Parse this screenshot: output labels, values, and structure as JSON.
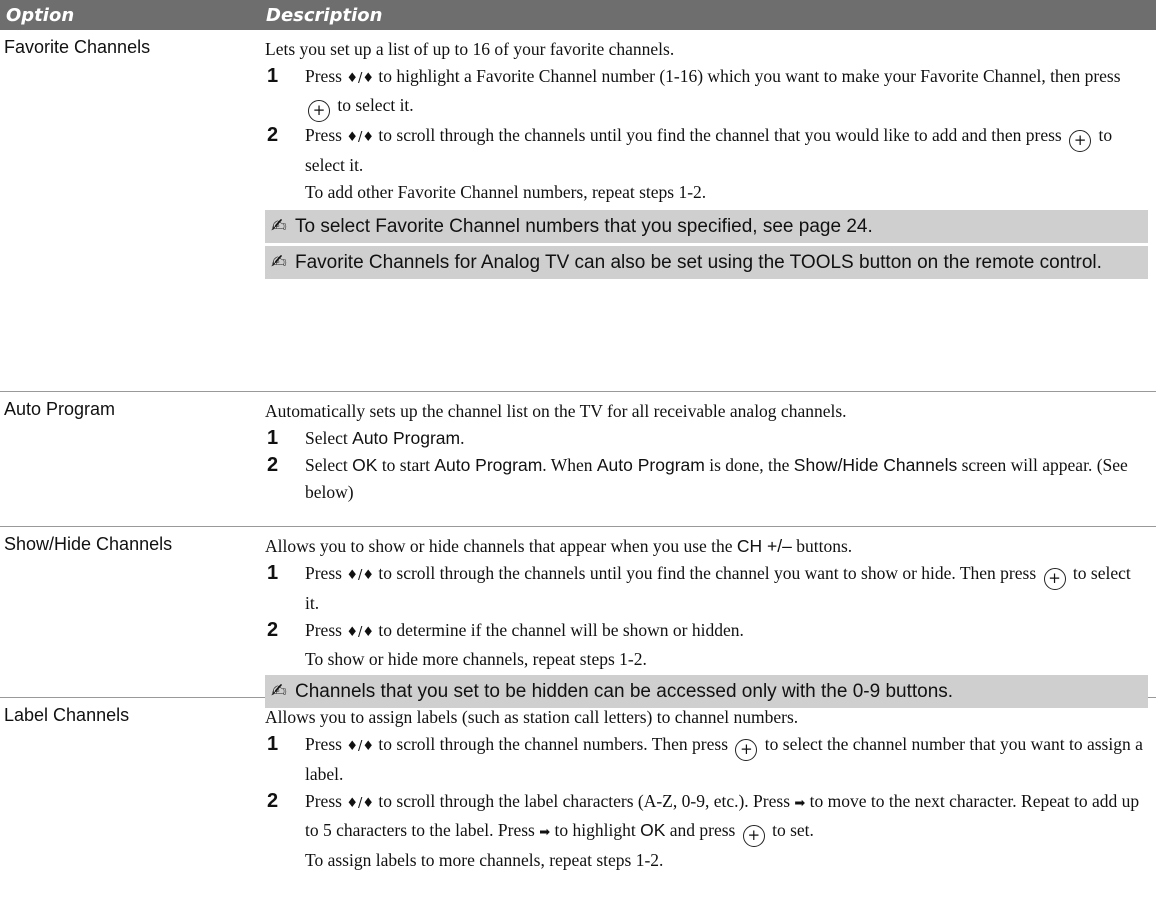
{
  "header": {
    "option": "Option",
    "description": "Description"
  },
  "rows": {
    "favorite": {
      "option": "Favorite Channels",
      "intro": "Lets you set up a list of up to 16 of your favorite channels.",
      "s1a": "Press ",
      "s1b": " to highlight a Favorite Channel number (1-16) which you want to make your Favorite Channel, then press ",
      "s1c": " to select it.",
      "s2a": "Press ",
      "s2b": " to scroll through the channels until you find the channel that you would like to add and then press ",
      "s2c": " to select it.",
      "after": "To add other Favorite Channel numbers, repeat steps 1-2.",
      "note1": "To select Favorite Channel numbers that you specified, see page 24.",
      "note2": "Favorite Channels for Analog TV can also be set using the TOOLS button on the remote control."
    },
    "auto": {
      "option": "Auto Program",
      "intro": "Automatically sets up the channel list on the TV for all receivable analog channels.",
      "s1a": "Select ",
      "s1b": "Auto Program",
      "s1c": ".",
      "s2a": "Select ",
      "s2b": "OK",
      "s2c": " to start ",
      "s2d": "Auto Program",
      "s2e": ". When ",
      "s2f": "Auto Program",
      "s2g": " is done, the ",
      "s2h": "Show/Hide Channels",
      "s2i": " screen will appear. (See below)"
    },
    "showhide": {
      "option": "Show/Hide Channels",
      "introA": "Allows you to show or hide channels that appear when you use the ",
      "introB": "CH +/–",
      "introC": " buttons.",
      "s1a": "Press ",
      "s1b": " to scroll through the channels until you find the channel you want to show or hide. Then press ",
      "s1c": " to select it.",
      "s2a": "Press ",
      "s2b": " to determine if the channel will be shown or hidden.",
      "after": "To show or hide more channels, repeat steps 1-2.",
      "note1": "Channels that you set to be hidden can be accessed only with the 0-9 buttons."
    },
    "label": {
      "option": "Label Channels",
      "intro": "Allows you to assign labels (such as station call letters) to channel numbers.",
      "s1a": "Press ",
      "s1b": " to scroll through the channel numbers. Then press ",
      "s1c": " to select the channel number that you want to assign a label.",
      "s2a": "Press ",
      "s2b": " to scroll through the label characters (A-Z, 0-9, etc.). Press ",
      "s2c": " to move to the next character. Repeat to add up to 5 characters to the label. Press ",
      "s2d": " to highlight ",
      "s2e": "OK",
      "s2f": " and press ",
      "s2g": " to set.",
      "after": "To assign labels to more channels, repeat steps 1-2."
    }
  },
  "symbols": {
    "updown": "♦/♦",
    "right": "➡",
    "enter": "+",
    "pen": "✍",
    "step1": "1",
    "step2": "2"
  },
  "colors": {
    "header_bg": "#6e6e6e",
    "note_bg": "#cfcfcf"
  }
}
